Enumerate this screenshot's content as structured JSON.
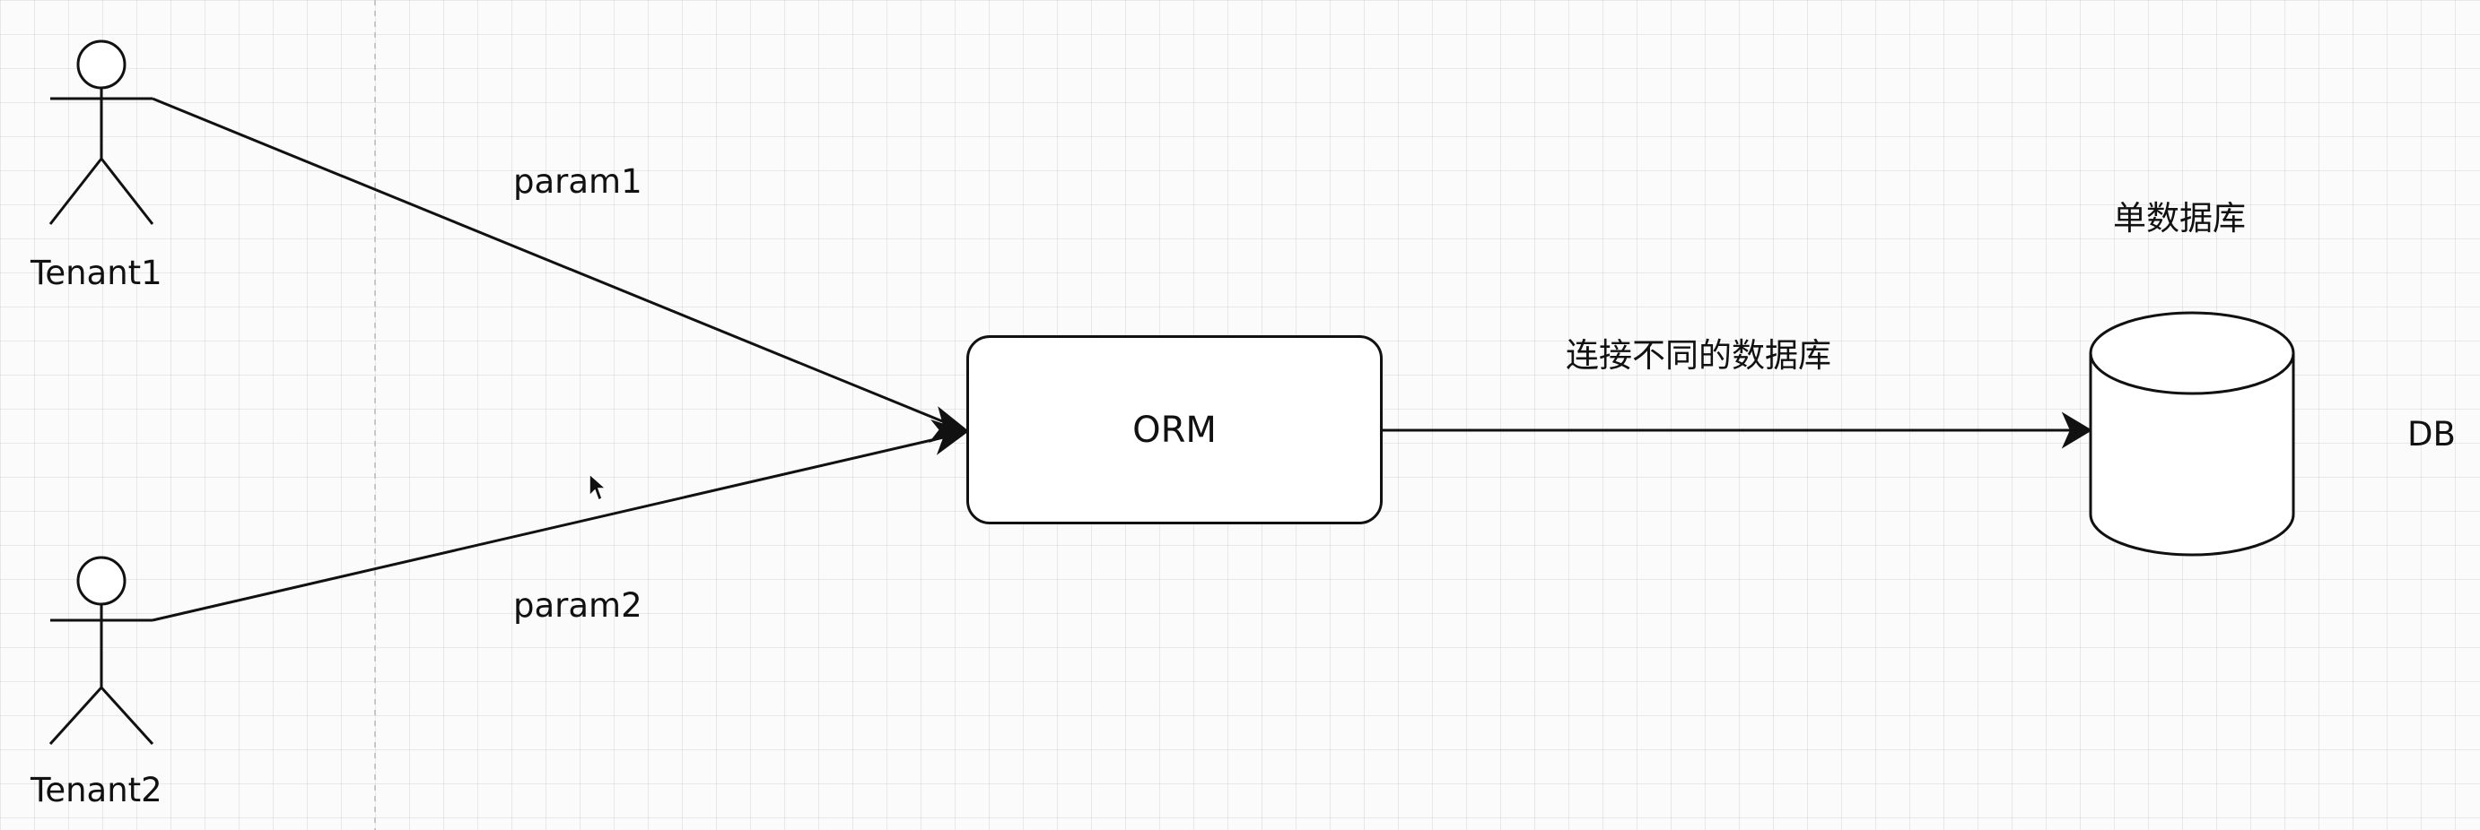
{
  "actors": [
    {
      "label": "Tenant1"
    },
    {
      "label": "Tenant2"
    }
  ],
  "edges": {
    "param1": "param1",
    "param2": "param2",
    "orm_to_db": "连接不同的数据库"
  },
  "orm": {
    "label": "ORM"
  },
  "database": {
    "title": "单数据库",
    "label": "DB"
  },
  "colors": {
    "stroke": "#111111",
    "background": "#fbfbfb",
    "grid": "#e3e3e3"
  }
}
